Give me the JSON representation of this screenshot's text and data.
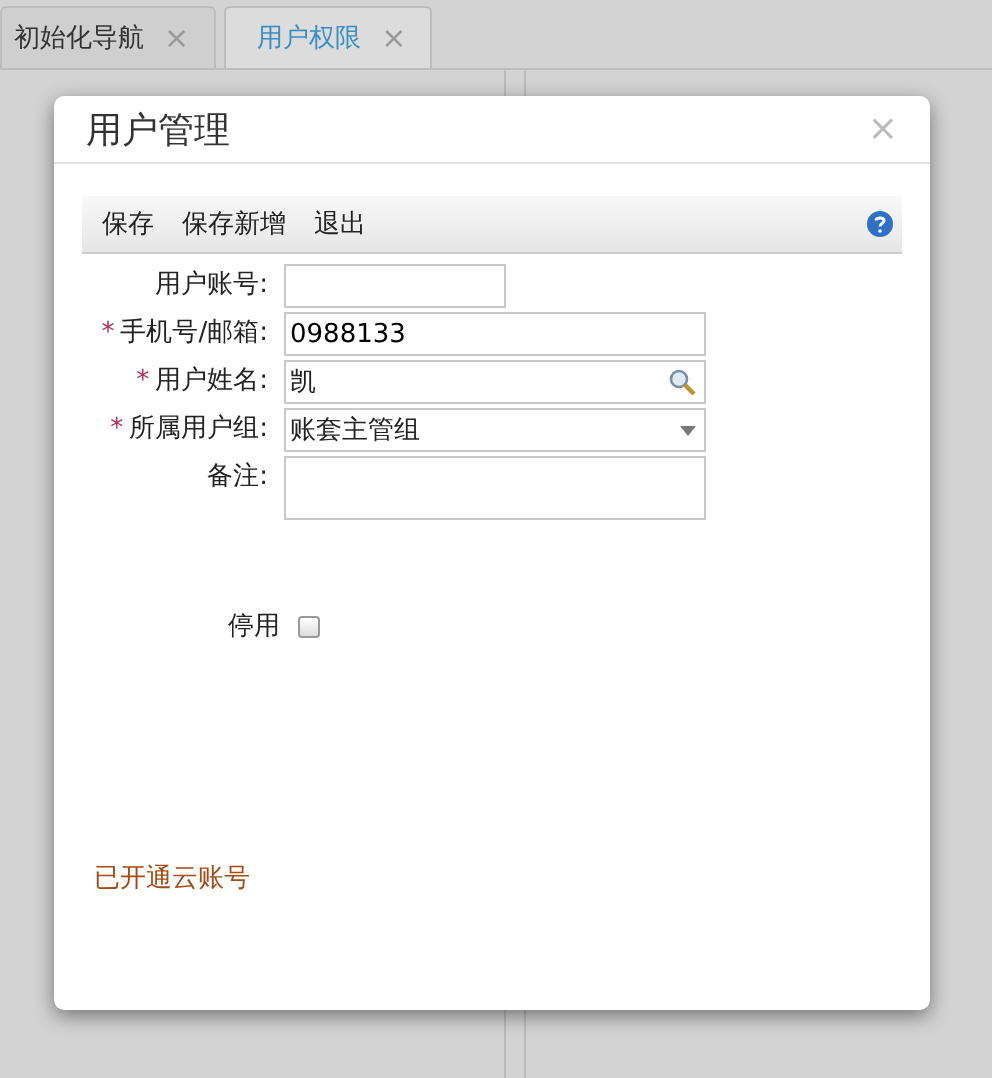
{
  "tabs": [
    {
      "label": "初始化导航",
      "close": "×",
      "selected": false
    },
    {
      "label": "用户权限",
      "close": "×",
      "selected": true
    }
  ],
  "dialog": {
    "title": "用户管理",
    "close": "×",
    "toolbar": [
      "保存",
      "保存新增",
      "退出"
    ],
    "fields": [
      {
        "kind": "short_text",
        "label": "用户账号:"
      },
      {
        "kind": "text",
        "required_mark": "*",
        "label": "手机号/邮箱:",
        "value": "0988133"
      },
      {
        "kind": "search",
        "required_mark": "*",
        "label": "用户姓名:",
        "value": "凯"
      },
      {
        "kind": "select",
        "required_mark": "*",
        "label": "所属用户组:",
        "value": "账套主管组"
      },
      {
        "kind": "textarea",
        "label": "备注:"
      }
    ],
    "disable": {
      "label": "停用",
      "checked": false
    },
    "note": "已开通云账号"
  }
}
